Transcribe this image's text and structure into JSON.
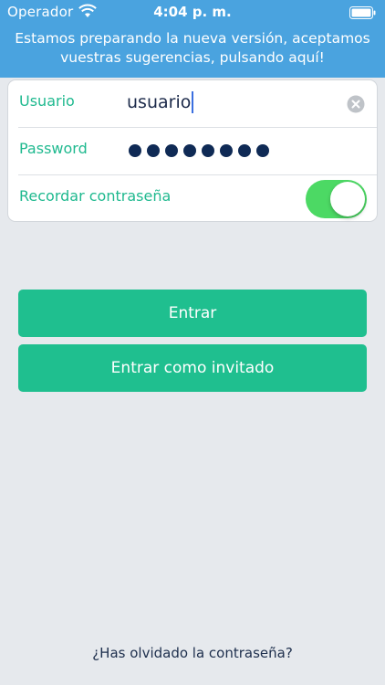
{
  "status_bar": {
    "carrier": "Operador",
    "time": "4:04 p. m.",
    "wifi_icon": "wifi-icon",
    "battery_icon": "battery-icon"
  },
  "banner": {
    "text": "Estamos preparando la nueva versión, aceptamos vuestras sugerencias, pulsando aquí!"
  },
  "form": {
    "username_label": "Usuario",
    "username_value": "usuario",
    "clear_icon": "clear-icon",
    "password_label": "Password",
    "password_length": 8,
    "remember_label": "Recordar contraseña",
    "remember_on": true
  },
  "buttons": {
    "login": "Entrar",
    "guest": "Entrar como invitado"
  },
  "forgot_password": "¿Has olvidado la contraseña?",
  "colors": {
    "header_blue": "#4aa3df",
    "accent_green": "#1fbf8f",
    "toggle_green": "#4cd964",
    "background": "#e6e9ed"
  }
}
